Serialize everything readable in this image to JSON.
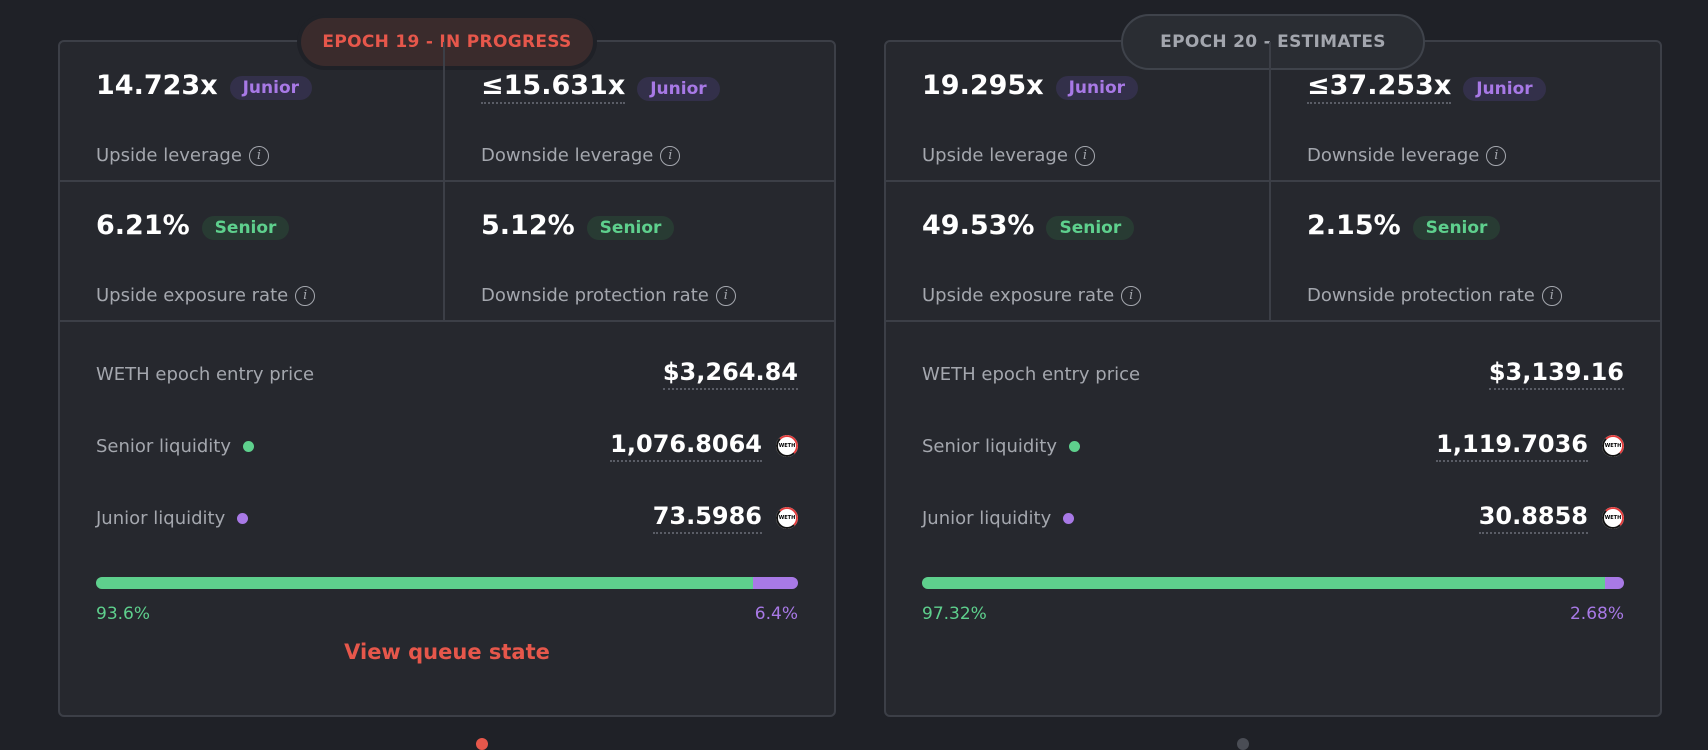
{
  "colors": {
    "background": "#1f2127",
    "card": "#26282e",
    "accent_red": "#e6574b",
    "senior_green": "#5ed08d",
    "junior_purple": "#a879e6",
    "muted_text": "#a4a7ae"
  },
  "epochs": [
    {
      "title": "EPOCH 19 - IN PROGRESS",
      "stats": {
        "upside_leverage": {
          "value": "14.723x",
          "badge": "Junior",
          "label": "Upside leverage"
        },
        "downside_leverage": {
          "value": "≤15.631x",
          "badge": "Junior",
          "label": "Downside leverage"
        },
        "upside_exposure": {
          "value": "6.21%",
          "badge": "Senior",
          "label": "Upside exposure rate"
        },
        "downside_protection": {
          "value": "5.12%",
          "badge": "Senior",
          "label": "Downside protection rate"
        }
      },
      "entry_price": {
        "label": "WETH epoch entry price",
        "value": "$3,264.84"
      },
      "senior_liquidity": {
        "label": "Senior liquidity",
        "value": "1,076.8064",
        "icon": "weth-token-icon"
      },
      "junior_liquidity": {
        "label": "Junior liquidity",
        "value": "73.5986",
        "icon": "weth-token-icon"
      },
      "split": {
        "senior_pct": 93.6,
        "junior_pct": 6.4,
        "senior_label": "93.6%",
        "junior_label": "6.4%"
      },
      "link": "View queue state"
    },
    {
      "title": "EPOCH 20 - ESTIMATES",
      "stats": {
        "upside_leverage": {
          "value": "19.295x",
          "badge": "Junior",
          "label": "Upside leverage"
        },
        "downside_leverage": {
          "value": "≤37.253x",
          "badge": "Junior",
          "label": "Downside leverage"
        },
        "upside_exposure": {
          "value": "49.53%",
          "badge": "Senior",
          "label": "Upside exposure rate"
        },
        "downside_protection": {
          "value": "2.15%",
          "badge": "Senior",
          "label": "Downside protection rate"
        }
      },
      "entry_price": {
        "label": "WETH epoch entry price",
        "value": "$3,139.16"
      },
      "senior_liquidity": {
        "label": "Senior liquidity",
        "value": "1,119.7036",
        "icon": "weth-token-icon"
      },
      "junior_liquidity": {
        "label": "Junior liquidity",
        "value": "30.8858",
        "icon": "weth-token-icon"
      },
      "split": {
        "senior_pct": 97.32,
        "junior_pct": 2.68,
        "senior_label": "97.32%",
        "junior_label": "2.68%"
      }
    }
  ],
  "info_icon_glyph": "i",
  "weth_icon_text": "WETH",
  "pager": {
    "total": 2,
    "active_index": 0
  }
}
